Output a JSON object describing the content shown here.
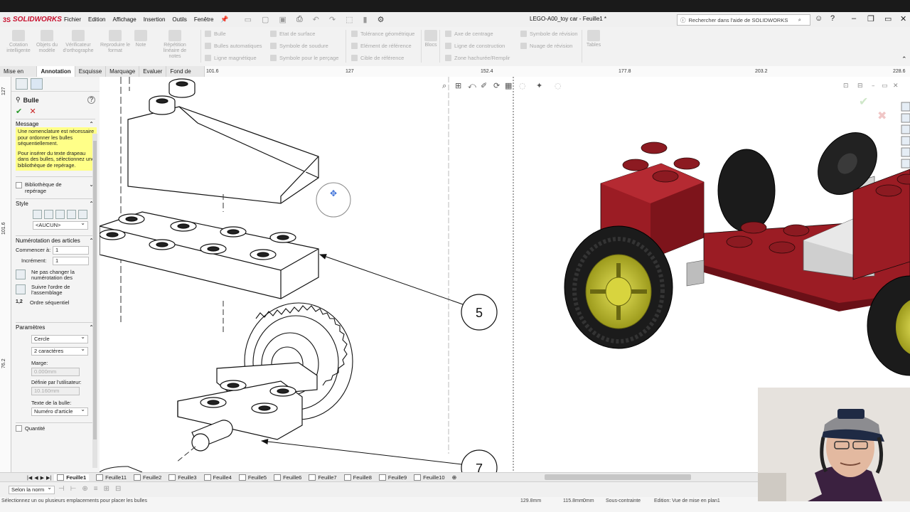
{
  "app": {
    "logo_text": "SOLIDWORKS",
    "logo_prefix": "3S",
    "window_title": "LEGO-A00_toy car - Feuille1 *",
    "help_placeholder": "Rechercher dans l'aide de SOLIDWORKS"
  },
  "menu": [
    "Fichier",
    "Edition",
    "Affichage",
    "Insertion",
    "Outils",
    "Fenêtre"
  ],
  "ribbon": {
    "big": [
      {
        "label": "Cotation intelligente"
      },
      {
        "label": "Objets du modèle"
      },
      {
        "label": "Vérificateur d'orthographe"
      },
      {
        "label": "Reproduire le format"
      },
      {
        "label": "Note"
      },
      {
        "label": "Répétition linéaire de notes"
      }
    ],
    "col1": [
      "Bulle",
      "Bulles automatiques",
      "Ligne magnétique"
    ],
    "col2": [
      "Etat de surface",
      "Symbole de soudure",
      "Symbole pour le perçage"
    ],
    "col3": [
      "Tolérance géométrique",
      "Elément de référence",
      "Cible de référence"
    ],
    "blocs": "Blocs",
    "col4": [
      "Axe de centrage",
      "Ligne de construction",
      "Zone hachurée/Remplir"
    ],
    "col5": [
      "Symbole de révision",
      "Nuage de révision"
    ],
    "tables": "Tables"
  },
  "tabs": [
    {
      "label": "Mise en plan"
    },
    {
      "label": "Annotation"
    },
    {
      "label": "Esquisse"
    },
    {
      "label": "Marquage"
    },
    {
      "label": "Evaluer"
    },
    {
      "label": "Fond de plan"
    }
  ],
  "ruler_top": [
    "101.6",
    "127",
    "152.4",
    "177.8",
    "203.2",
    "228.6"
  ],
  "ruler_left": [
    "127",
    "101.6",
    "76.2"
  ],
  "panel": {
    "title": "Bulle",
    "message_header": "Message",
    "message_p1": "Une nomenclature est nécessaire pour ordonner les bulles séquentiellement.",
    "message_p2": "Pour insérer du texte drapeau dans des bulles, sélectionnez une bibliothèque de repérage.",
    "library_label": "Bibliothèque de repérage",
    "style_header": "Style",
    "style_value": "<AUCUN>",
    "numbering_header": "Numérotation des articles",
    "start_label": "Commencer à:",
    "start_value": "1",
    "increment_label": "Incrément:",
    "increment_value": "1",
    "opt1": "Ne pas changer la numérotation des",
    "opt2": "Suivre l'ordre de l'assemblage",
    "opt3": "Ordre séquentiel",
    "opt3_icon": "1,2",
    "params_header": "Paramètres",
    "shape_value": "Cercle",
    "size_value": "2 caractères",
    "margin_label": "Marge:",
    "margin_value": "0.000mm",
    "user_label": "Définie par l'utilisateur:",
    "user_value": "10.160mm",
    "bubble_text_label": "Texte de la bulle:",
    "bubble_text_value": "Numéro d'article",
    "quantity_label": "Quantité"
  },
  "balloons": [
    "5",
    "7"
  ],
  "sheets": [
    "Feuille1",
    "Feuille11",
    "Feuille2",
    "Feuille3",
    "Feuille4",
    "Feuille5",
    "Feuille6",
    "Feuille7",
    "Feuille8",
    "Feuille9",
    "Feuille10"
  ],
  "status": {
    "scale_select": "Selon la norm",
    "hint": "Sélectionnez un ou plusieurs emplacements pour placer les bulles",
    "x": "129.8mm",
    "y": "115.8mm",
    "z": "0mm",
    "constraint": "Sous-contrainte",
    "edition": "Edition: Vue de mise en plan1"
  },
  "colors": {
    "brick": "#9b1c24",
    "rim": "#c9c62a",
    "tire": "#1b1b1b"
  }
}
